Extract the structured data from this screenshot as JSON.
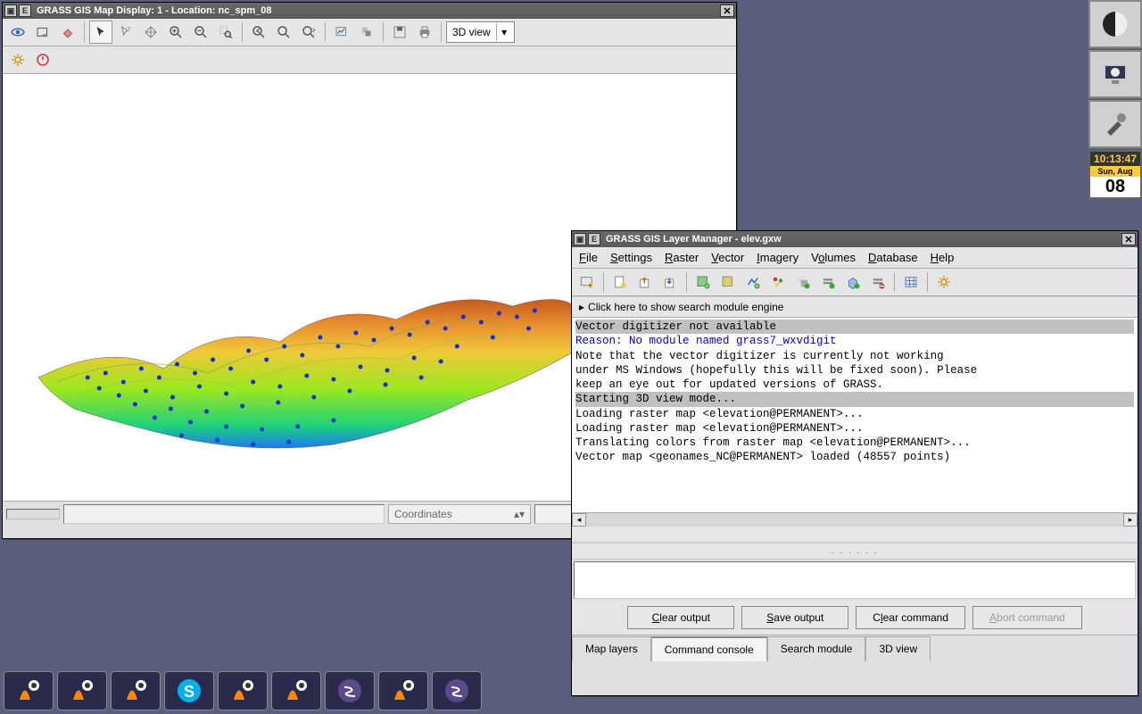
{
  "map_window": {
    "title": "GRASS GIS Map Display: 1  - Location: nc_spm_08",
    "view_mode": "3D view",
    "coord_label": "Coordinates"
  },
  "layer_window": {
    "title": "GRASS GIS Layer Manager - elev.gxw",
    "menu": [
      "File",
      "Settings",
      "Raster",
      "Vector",
      "Imagery",
      "Volumes",
      "Database",
      "Help"
    ],
    "search_hint": "Click here to show search module engine",
    "console": {
      "header1": "Vector digitizer not available",
      "reason": "Reason: No module named grass7_wxvdigit",
      "note1": "Note that the vector digitizer is currently not working",
      "note2": "under MS Windows (hopefully this will be fixed soon). Please",
      "note3": "keep an eye out for updated versions of GRASS.",
      "header2": "Starting 3D view mode...",
      "load1": "Loading raster map <elevation@PERMANENT>...",
      "load2": "Loading raster map <elevation@PERMANENT>...",
      "trans": "Translating colors from raster map <elevation@PERMANENT>...",
      "vec": "Vector map <geonames_NC@PERMANENT> loaded (48557 points)"
    },
    "buttons": {
      "clear_out": "Clear output",
      "save_out": "Save output",
      "clear_cmd": "Clear command",
      "abort_cmd": "Abort command"
    },
    "tabs": [
      "Map layers",
      "Command console",
      "Search module",
      "3D view"
    ],
    "active_tab": 1
  },
  "clock": {
    "time": "10:13:47",
    "day": "Sun, Aug",
    "date": "08"
  }
}
